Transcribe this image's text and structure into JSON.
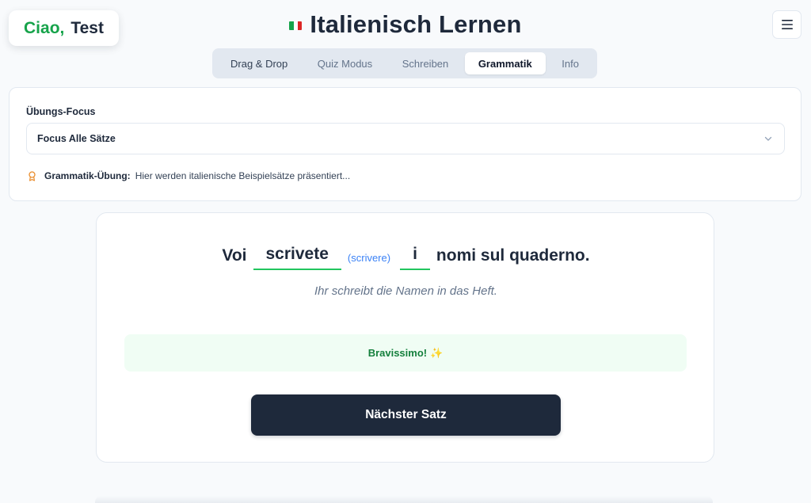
{
  "greeting": {
    "hello": "Ciao,",
    "name": "Test"
  },
  "header": {
    "flag_icon": "italy-flag-icon",
    "title": "Italienisch Lernen",
    "menu_icon": "hamburger-menu-icon"
  },
  "tabs": [
    {
      "label": "Drag & Drop",
      "active": false
    },
    {
      "label": "Quiz Modus",
      "active": false
    },
    {
      "label": "Schreiben",
      "active": false
    },
    {
      "label": "Grammatik",
      "active": true
    },
    {
      "label": "Info",
      "active": false
    }
  ],
  "focus": {
    "label": "Übungs-Focus",
    "selected": "Focus Alle Sätze",
    "info_title": "Grammatik-Übung:",
    "info_text": "Hier werden italienische Beispielsätze präsentiert..."
  },
  "exercise": {
    "word1": "Voi",
    "blank1": "scrivete",
    "hint": "(scrivere)",
    "blank2": "i",
    "rest": "nomi sul quaderno.",
    "translation": "Ihr schreibt die Namen in das Heft.",
    "feedback": "Bravissimo!",
    "feedback_icon": "✨",
    "next_label": "Nächster Satz"
  },
  "colors": {
    "accent_green": "#16a34a",
    "dark": "#1e293b",
    "hint_blue": "#3b82f6"
  }
}
